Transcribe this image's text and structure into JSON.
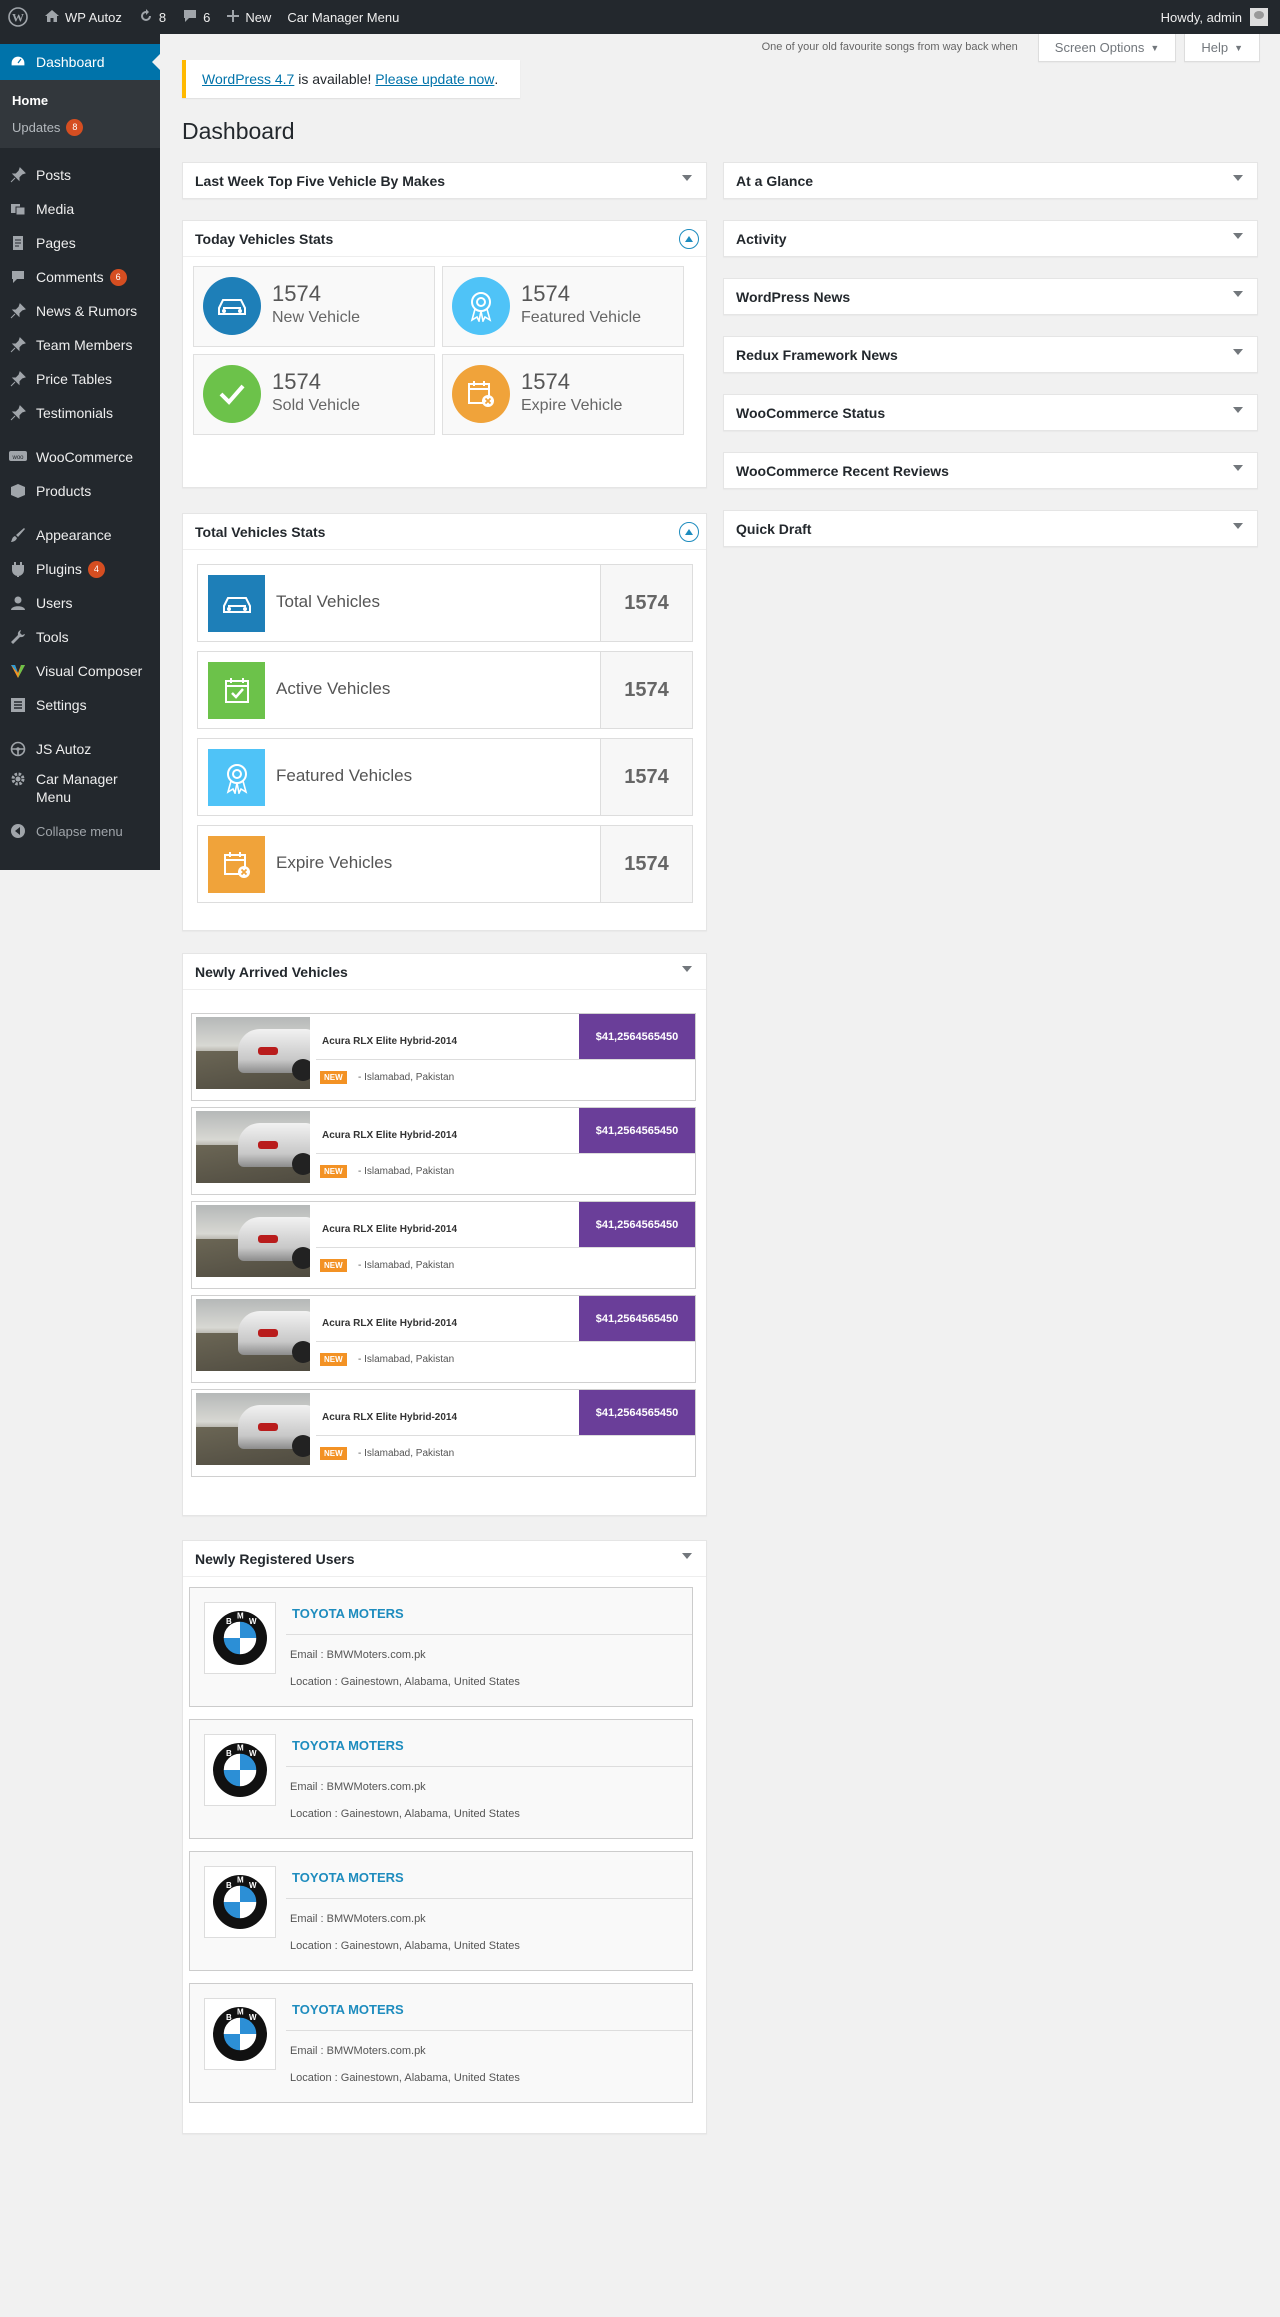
{
  "adminbar": {
    "site_name": "WP Autoz",
    "updates_count": "8",
    "comments_count": "6",
    "new_label": "New",
    "car_manager_label": "Car Manager Menu",
    "howdy": "Howdy, admin"
  },
  "sidebar": {
    "dashboard": "Dashboard",
    "home": "Home",
    "updates": "Updates",
    "updates_badge": "8",
    "items": [
      {
        "label": "Posts",
        "icon": "pin-icon"
      },
      {
        "label": "Media",
        "icon": "media-icon"
      },
      {
        "label": "Pages",
        "icon": "pages-icon"
      },
      {
        "label": "Comments",
        "icon": "comments-icon",
        "badge": "6"
      },
      {
        "label": "News & Rumors",
        "icon": "pin-icon"
      },
      {
        "label": "Team Members",
        "icon": "pin-icon"
      },
      {
        "label": "Price Tables",
        "icon": "pin-icon"
      },
      {
        "label": "Testimonials",
        "icon": "pin-icon"
      },
      {
        "label": "WooCommerce",
        "icon": "woo-icon"
      },
      {
        "label": "Products",
        "icon": "products-icon"
      },
      {
        "label": "Appearance",
        "icon": "brush-icon"
      },
      {
        "label": "Plugins",
        "icon": "plugin-icon",
        "badge": "4"
      },
      {
        "label": "Users",
        "icon": "users-icon"
      },
      {
        "label": "Tools",
        "icon": "wrench-icon"
      },
      {
        "label": "Visual Composer",
        "icon": "vc-icon"
      },
      {
        "label": "Settings",
        "icon": "settings-icon"
      },
      {
        "label": "JS Autoz",
        "icon": "steering-icon"
      },
      {
        "label": "Car Manager Menu",
        "icon": "gear-icon"
      }
    ],
    "collapse": "Collapse menu"
  },
  "topright": {
    "song": "One of your old favourite songs from way back when",
    "screen_options": "Screen Options",
    "help": "Help"
  },
  "notice": {
    "version_link": "WordPress 4.7",
    "middle": " is available! ",
    "update_link": "Please update now",
    "end": "."
  },
  "page_title": "Dashboard",
  "left_boxes": {
    "top_five": "Last Week Top Five Vehicle By Makes",
    "today_stats": "Today Vehicles Stats",
    "total_stats": "Total Vehicles Stats",
    "newly_arrived": "Newly Arrived Vehicles",
    "newly_registered": "Newly Registered Users"
  },
  "today_stats": [
    {
      "number": "1574",
      "label": "New Vehicle",
      "color": "#1e7fb8",
      "icon": "car-icon"
    },
    {
      "number": "1574",
      "label": "Featured Vehicle",
      "color": "#4fc3f7",
      "icon": "award-icon"
    },
    {
      "number": "1574",
      "label": "Sold Vehicle",
      "color": "#6cc24a",
      "icon": "check-icon"
    },
    {
      "number": "1574",
      "label": "Expire Vehicle",
      "color": "#f0a33a",
      "icon": "calendar-x-icon"
    }
  ],
  "total_stats": [
    {
      "label": "Total Vehicles",
      "value": "1574",
      "color": "#1e7fb8",
      "icon": "car-icon"
    },
    {
      "label": "Active Vehicles",
      "value": "1574",
      "color": "#6cc24a",
      "icon": "calendar-check-icon"
    },
    {
      "label": "Featured Vehicles",
      "value": "1574",
      "color": "#4fc3f7",
      "icon": "award-icon"
    },
    {
      "label": "Expire Vehicles",
      "value": "1574",
      "color": "#f0a33a",
      "icon": "calendar-x-icon"
    }
  ],
  "vehicles": [
    {
      "title": "Acura RLX Elite Hybrid-2014",
      "price": "$41,2564565450",
      "badge": "NEW",
      "location": "- Islamabad, Pakistan"
    },
    {
      "title": "Acura RLX Elite Hybrid-2014",
      "price": "$41,2564565450",
      "badge": "NEW",
      "location": "- Islamabad, Pakistan"
    },
    {
      "title": "Acura RLX Elite Hybrid-2014",
      "price": "$41,2564565450",
      "badge": "NEW",
      "location": "- Islamabad, Pakistan"
    },
    {
      "title": "Acura RLX Elite Hybrid-2014",
      "price": "$41,2564565450",
      "badge": "NEW",
      "location": "- Islamabad, Pakistan"
    },
    {
      "title": "Acura RLX Elite Hybrid-2014",
      "price": "$41,2564565450",
      "badge": "NEW",
      "location": "- Islamabad, Pakistan"
    }
  ],
  "users": [
    {
      "name": "TOYOTA MOTERS",
      "email": "Email : BMWMoters.com.pk",
      "location": "Location : Gainestown, Alabama, United States"
    },
    {
      "name": "TOYOTA MOTERS",
      "email": "Email : BMWMoters.com.pk",
      "location": "Location : Gainestown, Alabama, United States"
    },
    {
      "name": "TOYOTA MOTERS",
      "email": "Email : BMWMoters.com.pk",
      "location": "Location : Gainestown, Alabama, United States"
    },
    {
      "name": "TOYOTA MOTERS",
      "email": "Email : BMWMoters.com.pk",
      "location": "Location : Gainestown, Alabama, United States"
    }
  ],
  "right_boxes": [
    "At a Glance",
    "Activity",
    "WordPress News",
    "Redux Framework News",
    "WooCommerce Status",
    "WooCommerce Recent Reviews",
    "Quick Draft"
  ]
}
